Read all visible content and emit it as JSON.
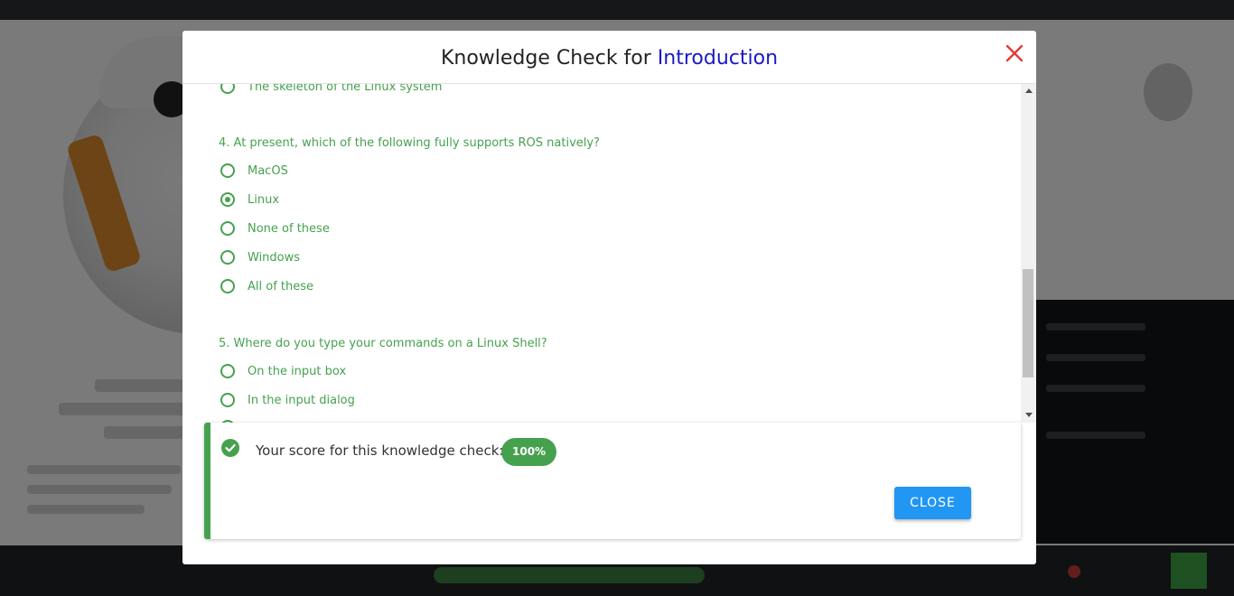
{
  "modal": {
    "title_prefix": "Knowledge Check for ",
    "title_highlight": "Introduction",
    "close_icon": "close-x-icon"
  },
  "questions": [
    {
      "title": "",
      "options": [
        {
          "label": "The skeleton of the Linux system",
          "checked": false
        }
      ]
    },
    {
      "title": "4. At present, which of the following fully supports ROS natively?",
      "options": [
        {
          "label": "MacOS",
          "checked": false
        },
        {
          "label": "Linux",
          "checked": true
        },
        {
          "label": "None of these",
          "checked": false
        },
        {
          "label": "Windows",
          "checked": false
        },
        {
          "label": "All of these",
          "checked": false
        }
      ]
    },
    {
      "title": "5. Where do you type your commands on a Linux Shell?",
      "options": [
        {
          "label": "On the input box",
          "checked": false
        },
        {
          "label": "In the input dialog",
          "checked": false
        }
      ]
    }
  ],
  "result": {
    "icon": "check-circle-icon",
    "text": "Your score for this knowledge check:",
    "score": "100%",
    "close_label": "CLOSE"
  },
  "colors": {
    "accent_green": "#46a14f",
    "title_highlight": "#1919c8",
    "close_x": "#e53935",
    "button_blue": "#2196f3"
  }
}
